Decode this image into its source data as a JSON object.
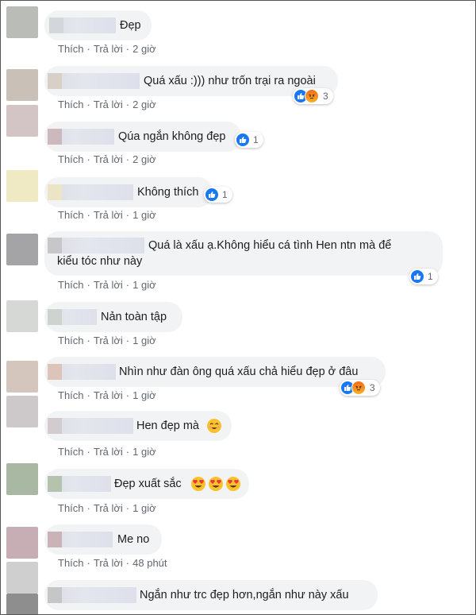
{
  "actions": {
    "like": "Thích",
    "reply": "Trả lời",
    "separator": "·"
  },
  "comments": [
    {
      "text": "Đẹp",
      "time": "2 giờ"
    },
    {
      "text": "Quá xấu :))) như trốn trại ra ngoài",
      "time": "2 giờ",
      "reactions": "3"
    },
    {
      "text": "Qúa ngắn không đẹp",
      "time": "2 giờ",
      "reactions": "1"
    },
    {
      "text": "Không thích",
      "time": "1 giờ",
      "reactions": "1"
    },
    {
      "text_line1": "Quá là xấu ạ.Không hiểu cá tình Hen ntn mà để",
      "text_line2": "kiểu tóc như này",
      "time": "1 giờ",
      "reactions": "1"
    },
    {
      "text": "Nản toàn tập",
      "time": "1 giờ"
    },
    {
      "text": "Nhìn như đàn ông quá xấu chả hiểu đẹp ở đâu",
      "time": "1 giờ",
      "reactions": "3"
    },
    {
      "text": "Hen đẹp mà",
      "time": "1 giờ"
    },
    {
      "text": "Đẹp xuất sắc",
      "time": "1 giờ"
    },
    {
      "text": "Me no",
      "time": "48 phút"
    },
    {
      "text": "Ngắn như trc đẹp hơn,ngắn như này xấu"
    }
  ],
  "icons": {
    "like": "thumbs-up-icon",
    "angry": "angry-face-icon",
    "smile": "smiling-face-icon",
    "heart_eyes": "heart-eyes-icon"
  },
  "colors": {
    "like_blue": "#1877f2",
    "bubble_bg": "#f2f3f5",
    "meta_gray": "#606770"
  }
}
